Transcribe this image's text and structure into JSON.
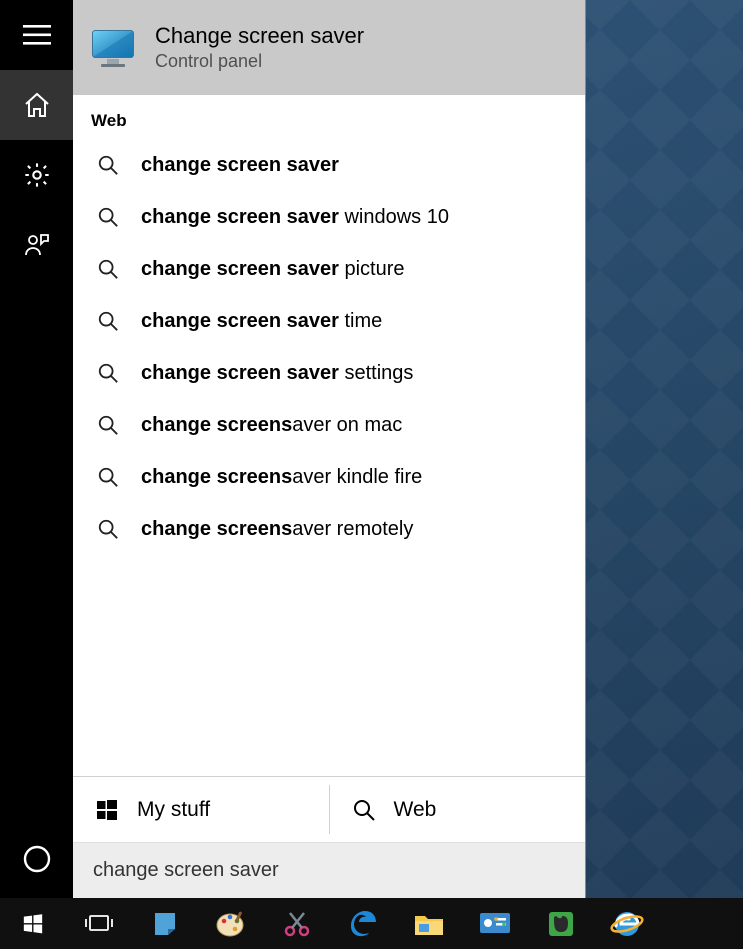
{
  "rail": {
    "menu": "menu",
    "home": "home",
    "settings": "settings",
    "people": "people",
    "cortana": "cortana"
  },
  "best_match": {
    "title": "Change screen saver",
    "subtitle": "Control panel"
  },
  "section_label": "Web",
  "suggestions": [
    {
      "bold": "change screen saver",
      "rest": ""
    },
    {
      "bold": "change screen saver",
      "rest": " windows 10"
    },
    {
      "bold": "change screen saver",
      "rest": " picture"
    },
    {
      "bold": "change screen saver",
      "rest": " time"
    },
    {
      "bold": "change screen saver",
      "rest": " settings"
    },
    {
      "bold": "change screens",
      "rest": "aver on mac"
    },
    {
      "bold": "change screens",
      "rest": "aver kindle fire"
    },
    {
      "bold": "change screens",
      "rest": "aver remotely"
    }
  ],
  "scope": {
    "my_stuff": "My stuff",
    "web": "Web"
  },
  "search_input": {
    "value": "change screen saver"
  },
  "taskbar": {
    "items": [
      "start",
      "task-view",
      "sticky-notes",
      "paint",
      "snipping-tool",
      "edge",
      "file-explorer",
      "control-panel",
      "evernote",
      "internet-explorer"
    ]
  }
}
